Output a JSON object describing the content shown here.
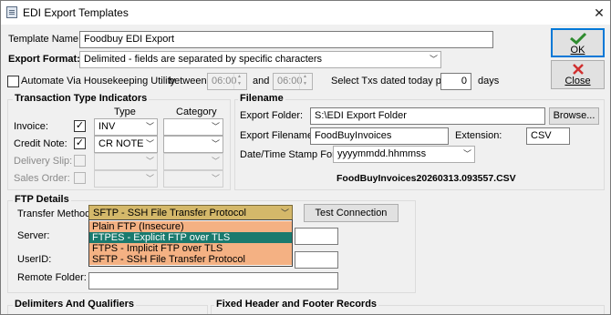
{
  "window": {
    "title": "EDI Export Templates",
    "close_glyph": "✕"
  },
  "template": {
    "name_label": "Template Name:",
    "name_value": "Foodbuy EDI Export"
  },
  "export_format": {
    "label": "Export Format:",
    "value": "Delimited - fields are separated by specific characters"
  },
  "housekeeping": {
    "automate_label": "Automate Via Housekeeping Utility",
    "between_label": "between",
    "time_from": "06:00",
    "and_label": "and",
    "time_to": "06:00",
    "select_txs_label": "Select Txs dated today plus",
    "days_value": "0",
    "days_label": "days"
  },
  "buttons": {
    "ok": "OK",
    "close": "Close",
    "browse": "Browse...",
    "test_connection": "Test Connection"
  },
  "transaction_types": {
    "title": "Transaction Type Indicators",
    "type_header": "Type",
    "category_header": "Category",
    "rows": [
      {
        "label": "Invoice:",
        "checked": true,
        "type": "INV",
        "category": ""
      },
      {
        "label": "Credit Note:",
        "checked": true,
        "type": "CR NOTE",
        "category": ""
      },
      {
        "label": "Delivery Slip:",
        "checked": false,
        "type": "",
        "category": ""
      },
      {
        "label": "Sales Order:",
        "checked": false,
        "type": "",
        "category": ""
      }
    ]
  },
  "filename": {
    "title": "Filename",
    "folder_label": "Export Folder:",
    "folder_value": "S:\\EDI Export Folder",
    "filename_label": "Export Filename:",
    "filename_value": "FoodBuyInvoices",
    "extension_label": "Extension:",
    "extension_value": "CSV",
    "stamp_label": "Date/Time Stamp Format:",
    "stamp_value": "yyyymmdd.hhmmss",
    "preview": "FoodBuyInvoices20260313.093557.CSV"
  },
  "ftp": {
    "title": "FTP Details",
    "method_label": "Transfer Method:",
    "method_value": "SFTP - SSH File Transfer Protocol",
    "server_label": "Server:",
    "userid_label": "UserID:",
    "remote_folder_label": "Remote Folder:",
    "options": [
      "Plain FTP (Insecure)",
      "FTPES - Explicit FTP over TLS",
      "FTPS - Implicit FTP over TLS",
      "SFTP - SSH File Transfer Protocol"
    ]
  },
  "sections": {
    "delimiters": "Delimiters And Qualifiers",
    "fixed_records": "Fixed Header and Footer Records"
  },
  "colors": {
    "dropdown_selected": "#1a7a6e",
    "dropdown_bg": "#f4b183",
    "method_highlight": "#d4b86a",
    "ok_check": "#2e8b2e",
    "close_x": "#d03030"
  }
}
